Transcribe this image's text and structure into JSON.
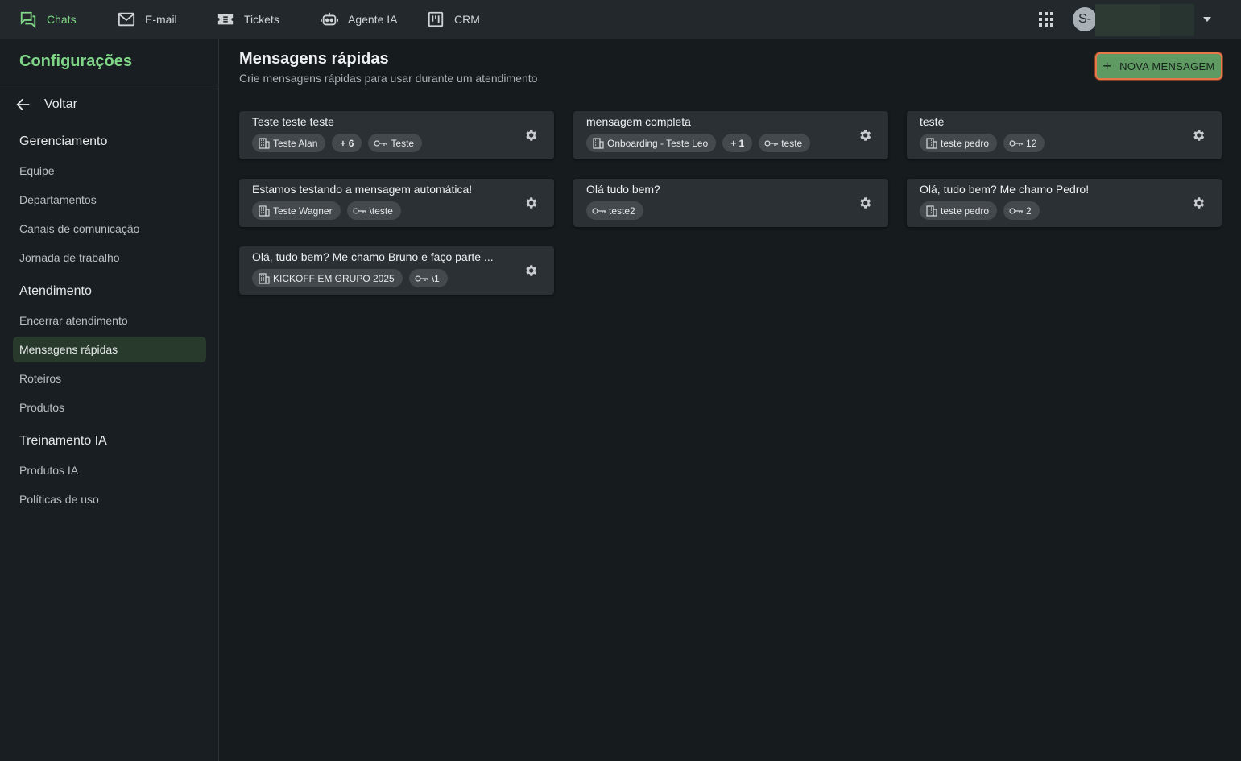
{
  "topnav": {
    "items": [
      {
        "label": "Chats",
        "icon": "chats-icon",
        "active": true
      },
      {
        "label": "E-mail",
        "icon": "email-icon"
      },
      {
        "label": "Tickets",
        "icon": "tickets-icon"
      },
      {
        "label": "Agente IA",
        "icon": "robot-icon"
      },
      {
        "label": "CRM",
        "icon": "crm-icon"
      }
    ],
    "user_initial": "S-"
  },
  "sidebar": {
    "title": "Configurações",
    "back_label": "Voltar",
    "sections": [
      {
        "title": "Gerenciamento",
        "items": [
          "Equipe",
          "Departamentos",
          "Canais de comunicação",
          "Jornada de trabalho"
        ]
      },
      {
        "title": "Atendimento",
        "items": [
          "Encerrar atendimento",
          "Mensagens rápidas",
          "Roteiros",
          "Produtos"
        ]
      },
      {
        "title": "Treinamento IA",
        "items": [
          "Produtos IA",
          "Políticas de uso"
        ]
      }
    ],
    "active_item": "Mensagens rápidas"
  },
  "main": {
    "title": "Mensagens rápidas",
    "subtitle": "Crie mensagens rápidas para usar durante um atendimento",
    "new_button_label": "NOVA MENSAGEM",
    "cards": [
      {
        "title": "Teste teste teste",
        "department": "Teste Alan",
        "extra": "+ 6",
        "shortcut": "Teste"
      },
      {
        "title": "mensagem completa",
        "department": "Onboarding - Teste Leo",
        "extra": "+ 1",
        "shortcut": "teste"
      },
      {
        "title": "teste",
        "department": "teste pedro",
        "shortcut": "12"
      },
      {
        "title": "Estamos testando a mensagem automática!",
        "department": "Teste Wagner",
        "shortcut": "\\teste"
      },
      {
        "title": "Olá tudo bem?",
        "shortcut": "teste2"
      },
      {
        "title": "Olá, tudo bem? Me chamo Pedro!",
        "department": "teste pedro",
        "shortcut": "2"
      },
      {
        "title": "Olá, tudo bem? Me chamo Bruno e faço parte ...",
        "department": "KICKOFF EM GRUPO 2025",
        "shortcut": "\\1"
      }
    ]
  },
  "colors": {
    "accent": "#7fd687",
    "button_bg": "#5f9a63",
    "button_focus_ring": "#e8774a",
    "card_bg": "#2a3034",
    "chip_bg": "#43494d"
  }
}
